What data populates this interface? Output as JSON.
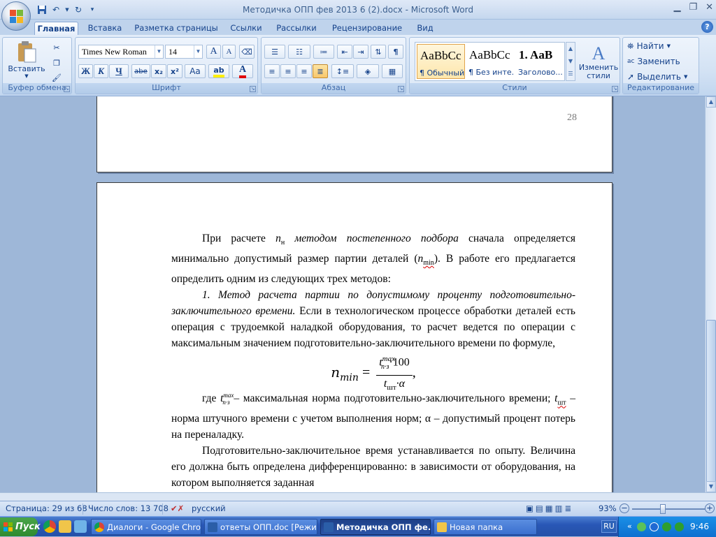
{
  "window": {
    "title": "Методичка ОПП фев 2013 6 (2).docx - Microsoft Word"
  },
  "tabs": [
    "Главная",
    "Вставка",
    "Разметка страницы",
    "Ссылки",
    "Рассылки",
    "Рецензирование",
    "Вид"
  ],
  "clipboard": {
    "paste": "Вставить",
    "label": "Буфер обмена"
  },
  "font": {
    "name": "Times New Roman",
    "size": "14",
    "label": "Шрифт",
    "bold": "Ж",
    "italic": "К",
    "underline": "Ч",
    "strike": "abe",
    "sub": "x₂",
    "sup": "x²",
    "case": "Aa",
    "grow": "A",
    "shrink": "A"
  },
  "paragraph": {
    "label": "Абзац"
  },
  "styles": {
    "label": "Стили",
    "items": [
      {
        "sample": "AaBbCc",
        "name": "¶ Обычный"
      },
      {
        "sample": "AaBbCc",
        "name": "¶ Без инте..."
      },
      {
        "sample": "1. AaB",
        "name": "Заголово..."
      }
    ],
    "change": "Изменить стили"
  },
  "editing": {
    "label": "Редактирование",
    "find": "Найти",
    "replace": "Заменить",
    "select": "Выделить"
  },
  "document": {
    "page_number": "28",
    "p1_a": "При расчете ",
    "p1_nh": "n",
    "p1_nh_sub": "н",
    "p1_method": " методом постепенного подбора",
    "p1_b": " сначала определяется минимально допустимый размер партии деталей (",
    "p1_nmin": "n",
    "p1_nmin_sub": "min",
    "p1_c": "). В работе его предлагается определить одним из следующих трех методов:",
    "p2_italic": "1. Метод расчета партии по допустимому проценту подготовительно-заключительного времени.",
    "p2_rest": " Если в технологическом процессе обработки деталей есть операция с трудоемкой наладкой оборудования, то расчет ведется по операции с максимальным значением подготовительно-заключительного времени по формуле,",
    "formula": {
      "lhs": "n",
      "lhs_sub": "min",
      "eq": " = ",
      "num_t": "t",
      "num_sup": "max",
      "num_sub": "п·з",
      "num_rest": "·100",
      "den_t": "t",
      "den_sub": "шт",
      "den_rest": "·α",
      "comma": ","
    },
    "p3_a": "где  ",
    "p3_t": "t",
    "p3_sup": "max",
    "p3_sub": "п·з",
    "p3_b": " – максимальная норма подготовительно-заключительного времени;  ",
    "p3_t2": "t",
    "p3_t2_sub": "шт",
    "p3_c": " – норма штучного времени с учетом выполнения норм; α – допустимый процент потерь на переналадку.",
    "p4": "Подготовительно-заключительное время устанавливается по опыту. Величина его должна быть определена дифференцированно: в зависимости от оборудования, на котором выполняется заданная"
  },
  "status": {
    "page": "Страница: 29 из 68",
    "words": "Число слов: 13 708",
    "lang": "русский",
    "zoom": "93%"
  },
  "taskbar": {
    "start": "Пуск",
    "items": [
      "Диалоги - Google Chrome",
      "ответы ОПП.doc [Режи...",
      "Методичка ОПП фе...",
      "Новая папка"
    ],
    "lang": "RU",
    "clock": "9:46"
  },
  "colors": {
    "accent": "#15428b",
    "ribbon": "#dbe7f6",
    "taskbar": "#2957b6"
  }
}
